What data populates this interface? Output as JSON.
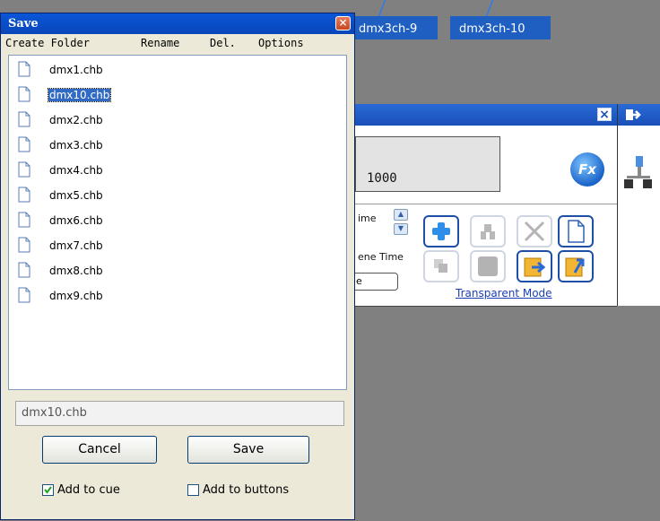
{
  "background": {
    "tabs": [
      {
        "label": "dmx3ch-9"
      },
      {
        "label": "dmx3ch-10"
      }
    ],
    "panel": {
      "value": "1000",
      "fx_label": "Fx",
      "time_label_1": "ime",
      "time_label_2": "ene Time",
      "scene_field_value": "e",
      "transparent_link": "Transparent Mode"
    }
  },
  "dialog": {
    "title": "Save",
    "menu": {
      "create_folder": "Create Folder",
      "rename": "Rename",
      "delete": "Del.",
      "options": "Options"
    },
    "files": [
      {
        "name": "dmx1.chb"
      },
      {
        "name": "dmx10.chb",
        "selected": true
      },
      {
        "name": "dmx2.chb"
      },
      {
        "name": "dmx3.chb"
      },
      {
        "name": "dmx4.chb"
      },
      {
        "name": "dmx5.chb"
      },
      {
        "name": "dmx6.chb"
      },
      {
        "name": "dmx7.chb"
      },
      {
        "name": "dmx8.chb"
      },
      {
        "name": "dmx9.chb"
      }
    ],
    "filename_value": "dmx10.chb",
    "cancel_label": "Cancel",
    "save_label": "Save",
    "add_to_cue": {
      "label": "Add to cue",
      "checked": true
    },
    "add_to_buttons": {
      "label": "Add to buttons",
      "checked": false
    }
  },
  "colors": {
    "title_bar": "#0a56d8",
    "selection": "#316ac5",
    "link": "#1b3fb5"
  }
}
